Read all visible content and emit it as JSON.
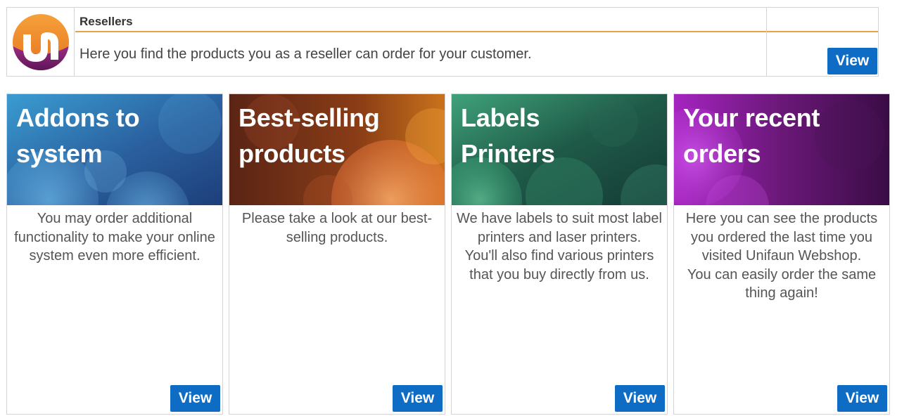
{
  "reseller": {
    "title": "Resellers",
    "description": "Here you find the products you as a reseller can order for your customer.",
    "view_label": "View",
    "logo_icon": "unifaun-logo-icon"
  },
  "cards": [
    {
      "title_line1": "Addons to",
      "title_line2": "system",
      "body": [
        "You may order additional functionality to make your online system even more efficient."
      ],
      "view_label": "View",
      "color": "#2a6fa8"
    },
    {
      "title_line1": "Best-selling",
      "title_line2": "products",
      "body": [
        "Please take a look at our best-selling products."
      ],
      "view_label": "View",
      "color": "#8a3b1c"
    },
    {
      "title_line1": "Labels",
      "title_line2": "Printers",
      "body": [
        "We have labels to suit most label printers and laser printers.",
        "You'll also find various printers that you buy directly from us."
      ],
      "view_label": "View",
      "color": "#1f5a45"
    },
    {
      "title_line1": "Your recent",
      "title_line2": "orders",
      "body": [
        "Here you can see the products you ordered the last time you visited Unifaun Webshop.",
        "You can easily order the same thing again!"
      ],
      "view_label": "View",
      "color": "#6a1a7a"
    }
  ],
  "colors": {
    "button": "#0f6cc4",
    "accent_line": "#e8a24a"
  }
}
